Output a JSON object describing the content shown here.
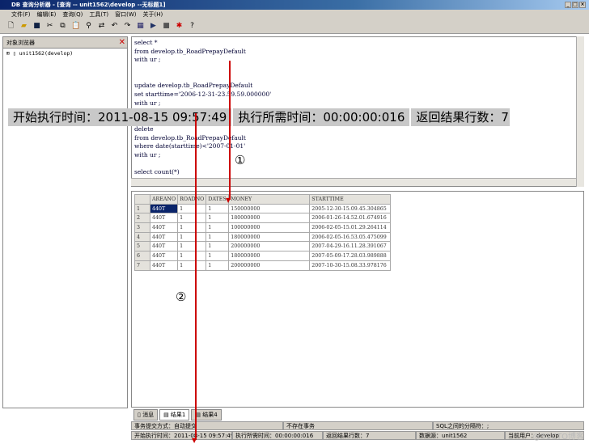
{
  "window": {
    "title": "DB 查询分析器 - [查询 -- unit1562\\develop --无标题1]"
  },
  "menu": [
    "文件(F)",
    "编辑(E)",
    "查询(Q)",
    "工具(T)",
    "窗口(W)",
    "关于(H)"
  ],
  "toolbar": {
    "icons": [
      "new-file-icon",
      "open-folder-icon",
      "save-icon",
      "cut-icon",
      "copy-icon",
      "paste-icon",
      "find-icon",
      "replace-icon",
      "undo-icon",
      "redo-icon",
      "grid-icon",
      "run-icon",
      "stop-icon",
      "debug-icon",
      "help-icon"
    ]
  },
  "object_browser": {
    "title": "对象浏览器",
    "tree_item": "unit1562(develop)"
  },
  "editor": {
    "lines": [
      "select *",
      "from develop.tb_RoadPrepayDefault",
      "with ur ;",
      "",
      "",
      "update develop.tb_RoadPrepayDefault",
      "set starttime='2006-12-31-23.59.59.000000'",
      "with ur ;",
      "",
      "",
      "delete",
      "from develop.tb_RoadPrepayDefault",
      "where date(starttime)<'2007-01-01'",
      "with ur ;",
      "",
      "select count(*)"
    ]
  },
  "banner": {
    "start": "开始执行时间：2011-08-15 09:57:49",
    "elapsed": "执行所需时间：00:00:00:016",
    "rows": "返回结果行数：7"
  },
  "annotations": {
    "one": "①",
    "two": "②"
  },
  "results": {
    "columns": [
      "",
      "AREANO",
      "ROADNO",
      "DATES",
      "MONEY",
      "STARTTIME"
    ],
    "rows": [
      [
        "1",
        "440T",
        "1",
        "1",
        "150000000",
        "2005-12-30-15.09.45.304865"
      ],
      [
        "2",
        "440T",
        "1",
        "1",
        "180000000",
        "2006-01-26-14.52.01.674916"
      ],
      [
        "3",
        "440T",
        "1",
        "1",
        "100000000",
        "2006-02-05-15.01.29.264114"
      ],
      [
        "4",
        "440T",
        "1",
        "1",
        "180000000",
        "2006-02-05-16.53.05.475099"
      ],
      [
        "5",
        "440T",
        "1",
        "1",
        "200000000",
        "2007-04-29-16.11.28.391067"
      ],
      [
        "6",
        "440T",
        "1",
        "1",
        "180000000",
        "2007-05-09-17.28.03.989888"
      ],
      [
        "7",
        "440T",
        "1",
        "1",
        "200000000",
        "2007-10-30-15.08.33.978176"
      ]
    ]
  },
  "tabs": [
    "消息",
    "结果1",
    "结果4"
  ],
  "status1": [
    "事务提交方式：自动提交",
    "不存在事务",
    "SQL之间的分隔符：;"
  ],
  "status2": [
    "开始执行时间：2011-08-15 09:57:49",
    "执行所需时间：00:00:00:016",
    "返回结果行数：7",
    "数据源：unit1562",
    "当前用户：develop"
  ],
  "watermark": "@51CTO博客"
}
